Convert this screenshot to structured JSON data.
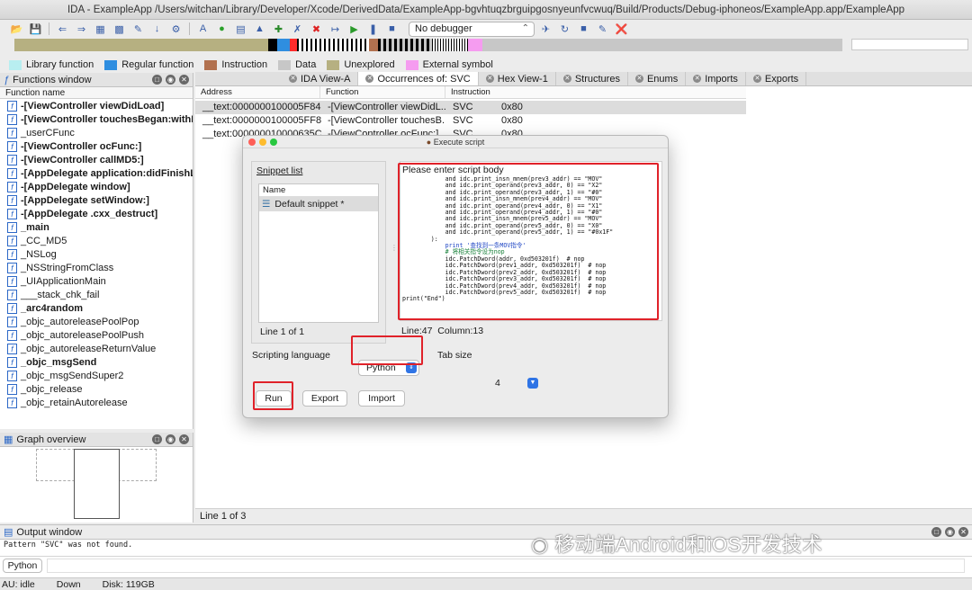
{
  "window": {
    "title": "IDA - ExampleApp /Users/witchan/Library/Developer/Xcode/DerivedData/ExampleApp-bgvhtuqzbrguipgosnyeunfvcwuq/Build/Products/Debug-iphoneos/ExampleApp.app/ExampleApp"
  },
  "toolbar": {
    "debugger": "No debugger"
  },
  "legend": [
    {
      "label": "Library function",
      "color": "#b8eef0"
    },
    {
      "label": "Regular function",
      "color": "#2f8ee0"
    },
    {
      "label": "Instruction",
      "color": "#b2714f"
    },
    {
      "label": "Data",
      "color": "#c7c7c7"
    },
    {
      "label": "Unexplored",
      "color": "#b6b081"
    },
    {
      "label": "External symbol",
      "color": "#f59cf0"
    }
  ],
  "functions_window": {
    "title": "Functions window",
    "column": "Function name",
    "items": [
      {
        "name": "-[ViewController viewDidLoad]",
        "bold": true
      },
      {
        "name": "-[ViewController touchesBegan:withEvent:]",
        "bold": true
      },
      {
        "name": "_userCFunc",
        "bold": false
      },
      {
        "name": "-[ViewController ocFunc:]",
        "bold": true
      },
      {
        "name": "-[ViewController callMD5:]",
        "bold": true
      },
      {
        "name": "-[AppDelegate application:didFinishLaunching]",
        "bold": true
      },
      {
        "name": "-[AppDelegate window]",
        "bold": true
      },
      {
        "name": "-[AppDelegate setWindow:]",
        "bold": true
      },
      {
        "name": "-[AppDelegate .cxx_destruct]",
        "bold": true
      },
      {
        "name": "_main",
        "bold": true
      },
      {
        "name": "_CC_MD5",
        "bold": false
      },
      {
        "name": "_NSLog",
        "bold": false
      },
      {
        "name": "_NSStringFromClass",
        "bold": false
      },
      {
        "name": "_UIApplicationMain",
        "bold": false
      },
      {
        "name": "___stack_chk_fail",
        "bold": false
      },
      {
        "name": "_arc4random",
        "bold": true
      },
      {
        "name": "_objc_autoreleasePoolPop",
        "bold": false
      },
      {
        "name": "_objc_autoreleasePoolPush",
        "bold": false
      },
      {
        "name": "_objc_autoreleaseReturnValue",
        "bold": false
      },
      {
        "name": "_objc_msgSend",
        "bold": true
      },
      {
        "name": "_objc_msgSendSuper2",
        "bold": false
      },
      {
        "name": "_objc_release",
        "bold": false
      },
      {
        "name": "_objc_retainAutorelease",
        "bold": false
      }
    ]
  },
  "graph_overview": {
    "title": "Graph overview"
  },
  "tabs": [
    {
      "label": "IDA View-A"
    },
    {
      "label": "Occurrences of: SVC",
      "active": true
    },
    {
      "label": "Hex View-1"
    },
    {
      "label": "Structures"
    },
    {
      "label": "Enums"
    },
    {
      "label": "Imports"
    },
    {
      "label": "Exports"
    }
  ],
  "occurrences": {
    "columns": [
      "Address",
      "Function",
      "Instruction",
      ""
    ],
    "rows": [
      {
        "address": "__text:0000000100005F84",
        "function": "-[ViewController viewDidL...",
        "instruction": "SVC",
        "operand": "0x80"
      },
      {
        "address": "__text:0000000100005FF8",
        "function": "-[ViewController touchesB...",
        "instruction": "SVC",
        "operand": "0x80"
      },
      {
        "address": "__text:000000010000635C",
        "function": "-[ViewController ocFunc:]",
        "instruction": "SVC",
        "operand": "0x80"
      }
    ],
    "status": "Line 1 of 3"
  },
  "dialog": {
    "title": "Execute script",
    "snippet_label": "Snippet list",
    "snippet_col": "Name",
    "snippet_item": "Default snippet *",
    "snippet_status": "Line 1 of 1",
    "body_label": "Please enter script body",
    "code_lines": [
      "            and idc.print_insn_mnem(prev3_addr) == \"MOV\"",
      "            and idc.print_operand(prev3_addr, 0) == \"X2\"",
      "            and idc.print_operand(prev3_addr, 1) == \"#0\"",
      "            and idc.print_insn_mnem(prev4_addr) == \"MOV\"",
      "            and idc.print_operand(prev4_addr, 0) == \"X1\"",
      "            and idc.print_operand(prev4_addr, 1) == \"#0\"",
      "            and idc.print_insn_mnem(prev5_addr) == \"MOV\"",
      "            and idc.print_operand(prev5_addr, 0) == \"X0\"",
      "            and idc.print_operand(prev5_addr, 1) == \"#0x1F\"",
      "        ):",
      "            print '查找到一条MOV指令'",
      "            # 将相关指令设为nop",
      "            idc.PatchDword(addr, 0xd503201f)  # nop",
      "            idc.PatchDword(prev1_addr, 0xd503201f)  # nop",
      "            idc.PatchDword(prev2_addr, 0xd503201f)  # nop",
      "            idc.PatchDword(prev3_addr, 0xd503201f)  # nop",
      "            idc.PatchDword(prev4_addr, 0xd503201f)  # nop",
      "            idc.PatchDword(prev5_addr, 0xd503201f)  # nop",
      "print(\"End\")"
    ],
    "cursor": "Line:47  Column:13",
    "lang_label": "Scripting language",
    "lang_value": "Python",
    "tab_label": "Tab size",
    "tab_value": "4",
    "run": "Run",
    "export": "Export",
    "import": "Import"
  },
  "output": {
    "title": "Output window",
    "message": "Pattern \"SVC\" was not found.",
    "lang": "Python"
  },
  "status": {
    "au": "AU:  idle",
    "dir": "Down",
    "disk": "Disk: 119GB"
  },
  "watermark": "移动端Android和iOS开发技术"
}
